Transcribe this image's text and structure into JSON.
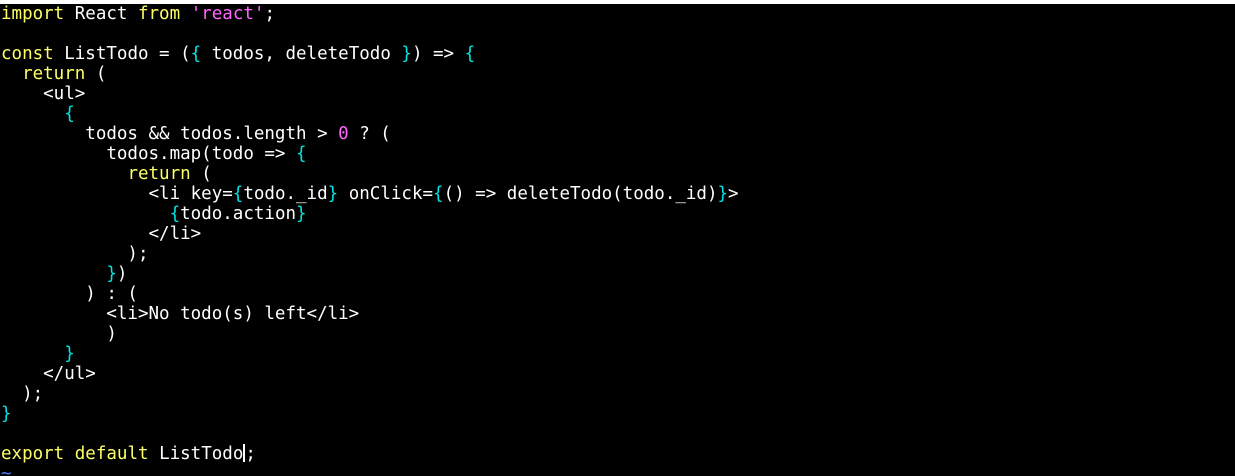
{
  "editor": {
    "colors": {
      "background": "#000000",
      "default_text": "#ffffff",
      "keyword": "#ffff66",
      "string": "#ff66ff",
      "number": "#ff66ff",
      "brace": "#00e5e5",
      "tilde": "#4d7fff"
    },
    "lines": [
      [
        {
          "t": "import",
          "k": "keyword"
        },
        {
          "t": " React ",
          "k": "default_text"
        },
        {
          "t": "from",
          "k": "keyword"
        },
        {
          "t": " ",
          "k": "default_text"
        },
        {
          "t": "'react'",
          "k": "string"
        },
        {
          "t": ";",
          "k": "default_text"
        }
      ],
      [],
      [
        {
          "t": "const",
          "k": "keyword"
        },
        {
          "t": " ListTodo = (",
          "k": "default_text"
        },
        {
          "t": "{",
          "k": "brace"
        },
        {
          "t": " todos, deleteTodo ",
          "k": "default_text"
        },
        {
          "t": "}",
          "k": "brace"
        },
        {
          "t": ") => ",
          "k": "default_text"
        },
        {
          "t": "{",
          "k": "brace"
        }
      ],
      [
        {
          "t": "  ",
          "k": "default_text"
        },
        {
          "t": "return",
          "k": "keyword"
        },
        {
          "t": " (",
          "k": "default_text"
        }
      ],
      [
        {
          "t": "    <ul>",
          "k": "default_text"
        }
      ],
      [
        {
          "t": "      ",
          "k": "default_text"
        },
        {
          "t": "{",
          "k": "brace"
        }
      ],
      [
        {
          "t": "        todos && todos.length > ",
          "k": "default_text"
        },
        {
          "t": "0",
          "k": "number"
        },
        {
          "t": " ? (",
          "k": "default_text"
        }
      ],
      [
        {
          "t": "          todos.map(todo => ",
          "k": "default_text"
        },
        {
          "t": "{",
          "k": "brace"
        }
      ],
      [
        {
          "t": "            ",
          "k": "default_text"
        },
        {
          "t": "return",
          "k": "keyword"
        },
        {
          "t": " (",
          "k": "default_text"
        }
      ],
      [
        {
          "t": "              <li key=",
          "k": "default_text"
        },
        {
          "t": "{",
          "k": "brace"
        },
        {
          "t": "todo._id",
          "k": "default_text"
        },
        {
          "t": "}",
          "k": "brace"
        },
        {
          "t": " onClick=",
          "k": "default_text"
        },
        {
          "t": "{",
          "k": "brace"
        },
        {
          "t": "() => deleteTodo(todo._id)",
          "k": "default_text"
        },
        {
          "t": "}",
          "k": "brace"
        },
        {
          "t": ">",
          "k": "default_text"
        }
      ],
      [
        {
          "t": "                ",
          "k": "default_text"
        },
        {
          "t": "{",
          "k": "brace"
        },
        {
          "t": "todo.action",
          "k": "default_text"
        },
        {
          "t": "}",
          "k": "brace"
        }
      ],
      [
        {
          "t": "              </li>",
          "k": "default_text"
        }
      ],
      [
        {
          "t": "            );",
          "k": "default_text"
        }
      ],
      [
        {
          "t": "          ",
          "k": "default_text"
        },
        {
          "t": "}",
          "k": "brace"
        },
        {
          "t": ")",
          "k": "default_text"
        }
      ],
      [
        {
          "t": "        ) : (",
          "k": "default_text"
        }
      ],
      [
        {
          "t": "          <li>No todo(s) left</li>",
          "k": "default_text"
        }
      ],
      [
        {
          "t": "          )",
          "k": "default_text"
        }
      ],
      [
        {
          "t": "      ",
          "k": "default_text"
        },
        {
          "t": "}",
          "k": "brace"
        }
      ],
      [
        {
          "t": "    </ul>",
          "k": "default_text"
        }
      ],
      [
        {
          "t": "  );",
          "k": "default_text"
        }
      ],
      [
        {
          "t": "}",
          "k": "brace"
        }
      ],
      [],
      [
        {
          "t": "export",
          "k": "keyword"
        },
        {
          "t": " ",
          "k": "default_text"
        },
        {
          "t": "default",
          "k": "keyword"
        },
        {
          "t": " ListTodo",
          "k": "default_text"
        },
        {
          "t": "|",
          "k": "cursor"
        },
        {
          "t": ";",
          "k": "default_text"
        }
      ],
      [
        {
          "t": "~",
          "k": "tilde"
        }
      ]
    ]
  }
}
